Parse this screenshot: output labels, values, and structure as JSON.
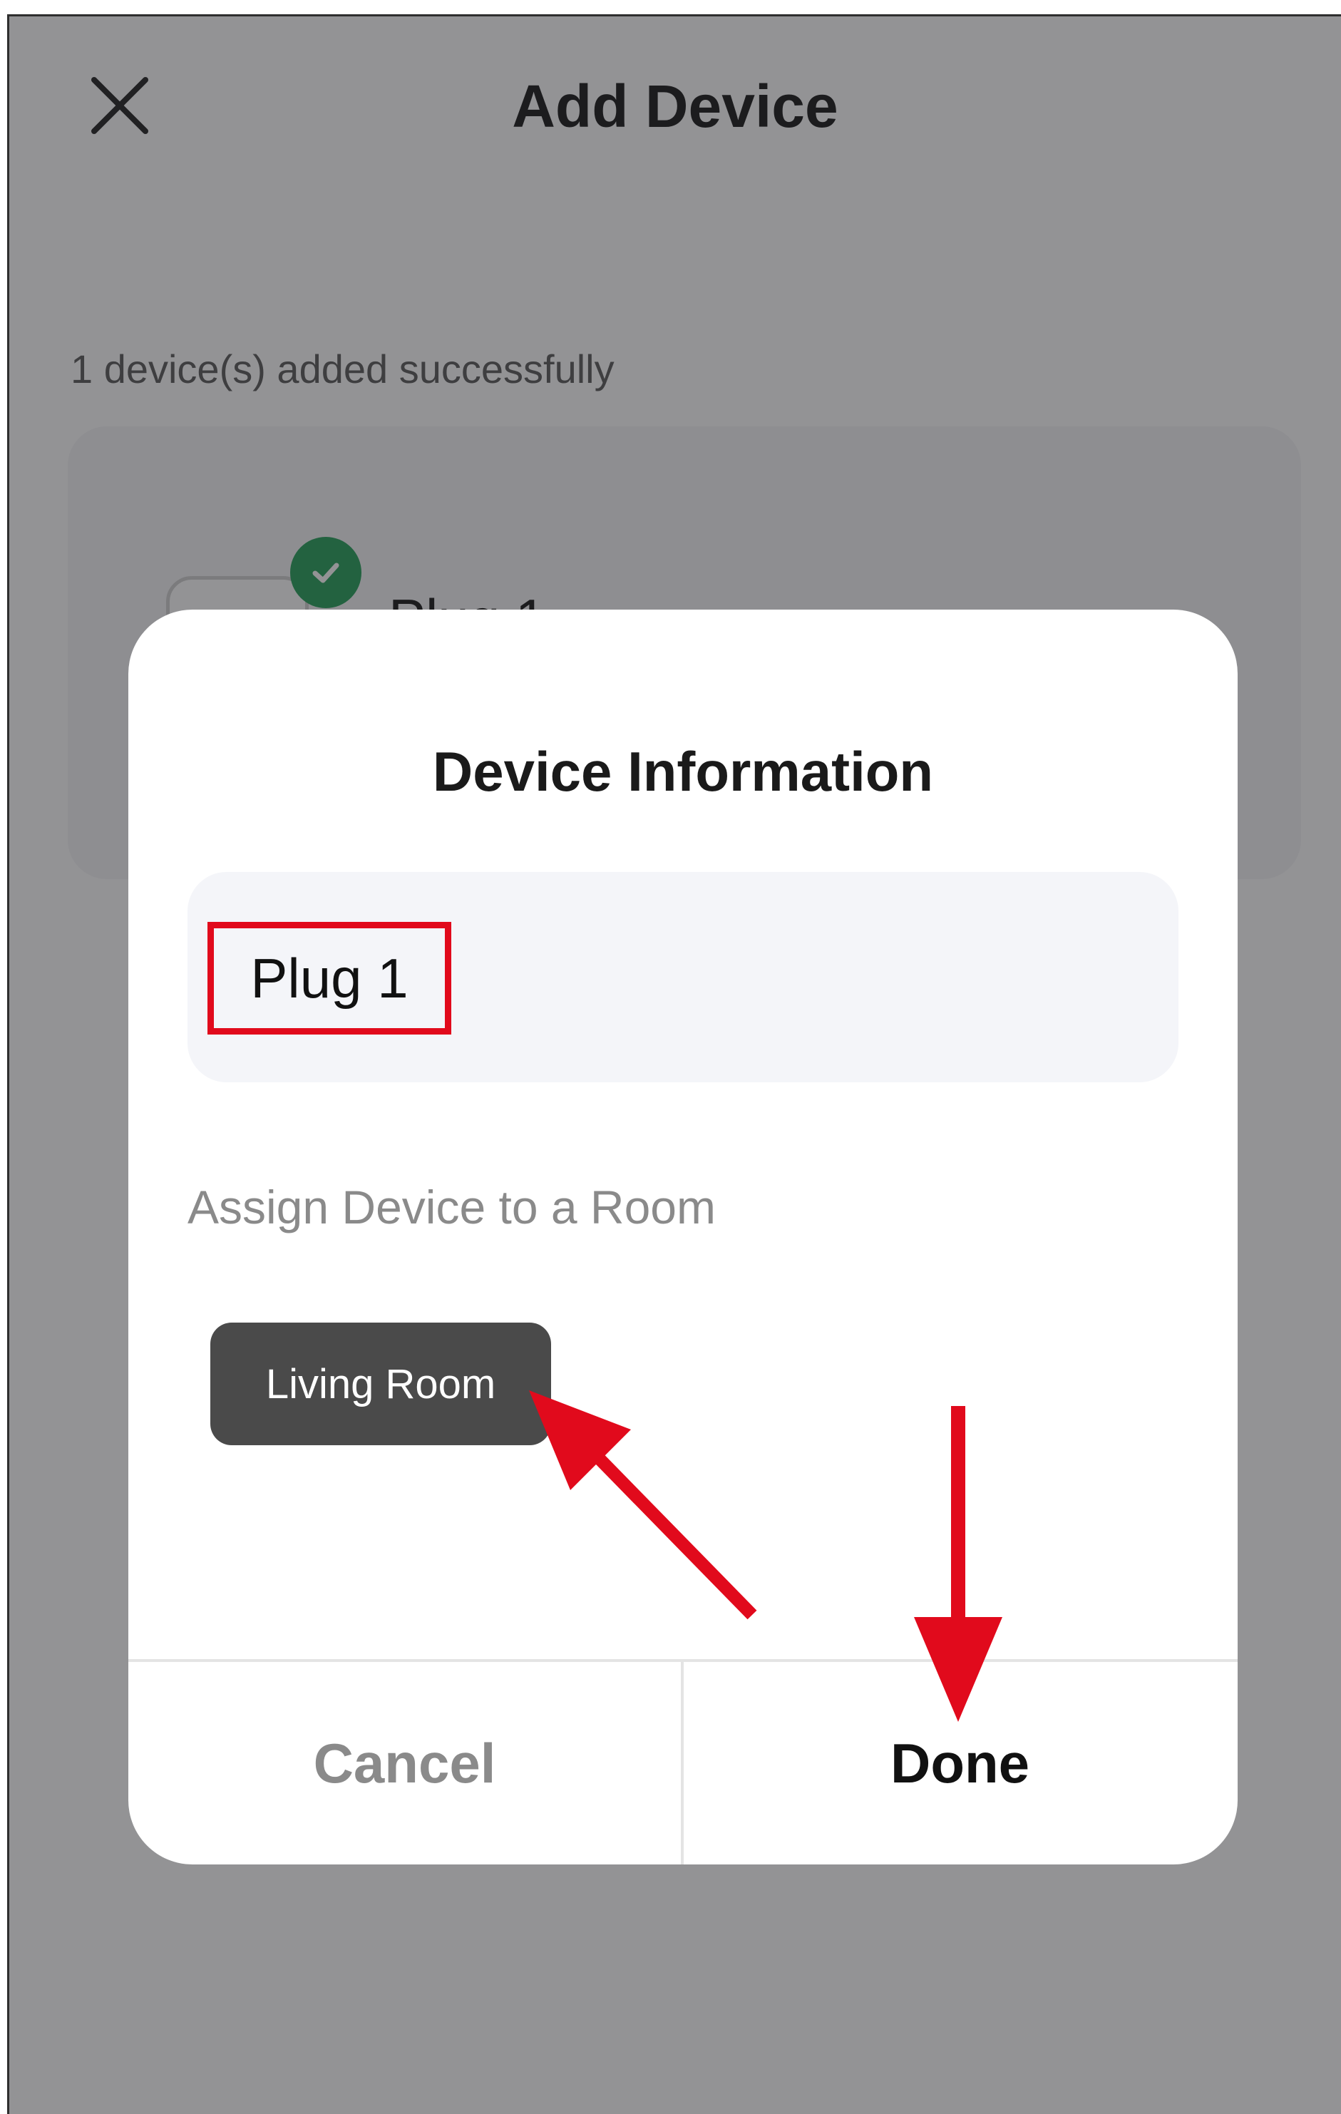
{
  "header": {
    "title": "Add Device",
    "close_icon": "close-icon"
  },
  "status": {
    "success_message": "1 device(s) added successfully"
  },
  "device_card": {
    "name": "Plug 1",
    "badge_icon": "check-circle-icon"
  },
  "dialog": {
    "title": "Device Information",
    "name_value": "Plug 1",
    "assign_label": "Assign Device to a Room",
    "room_chip": "Living Room",
    "cancel_label": "Cancel",
    "done_label": "Done"
  },
  "colors": {
    "annotation_red": "#e10a1c",
    "success_green": "#1f9d55",
    "chip_bg": "#4a4a4a"
  }
}
